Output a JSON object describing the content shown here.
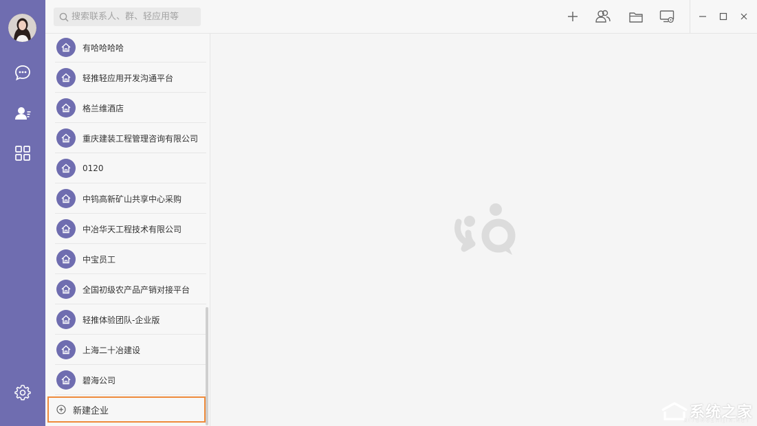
{
  "search": {
    "placeholder": "搜索联系人、群、轻应用等"
  },
  "rail": {
    "items": [
      {
        "name": "chat-bubble-icon"
      },
      {
        "name": "contacts-icon"
      },
      {
        "name": "apps-grid-icon"
      }
    ],
    "settings": "gear-icon"
  },
  "toolbar": {
    "icons": [
      "plus-icon",
      "group-icon",
      "folder-icon",
      "screen-share-icon"
    ]
  },
  "window": {
    "controls": [
      "minimize-icon",
      "maximize-icon",
      "close-icon"
    ]
  },
  "orgs": [
    {
      "label": "有哈哈哈哈"
    },
    {
      "label": "轻推轻应用开发沟通平台"
    },
    {
      "label": "格兰维酒店"
    },
    {
      "label": "重庆建装工程管理咨询有限公司"
    },
    {
      "label": "0120"
    },
    {
      "label": "中钨高新矿山共享中心采购"
    },
    {
      "label": "中冶华天工程技术有限公司"
    },
    {
      "label": "中宝员工"
    },
    {
      "label": "全国初级农产品产销对接平台"
    },
    {
      "label": "轻推体验团队-企业版"
    },
    {
      "label": "上海二十冶建设"
    },
    {
      "label": "碧海公司"
    }
  ],
  "new_org": {
    "label": "新建企业"
  },
  "watermark": {
    "text": "系统之家",
    "sub": "XITONGZHIJIA.NET"
  },
  "colors": {
    "brand": "#6f6db0",
    "highlight": "#ee8a3a"
  }
}
